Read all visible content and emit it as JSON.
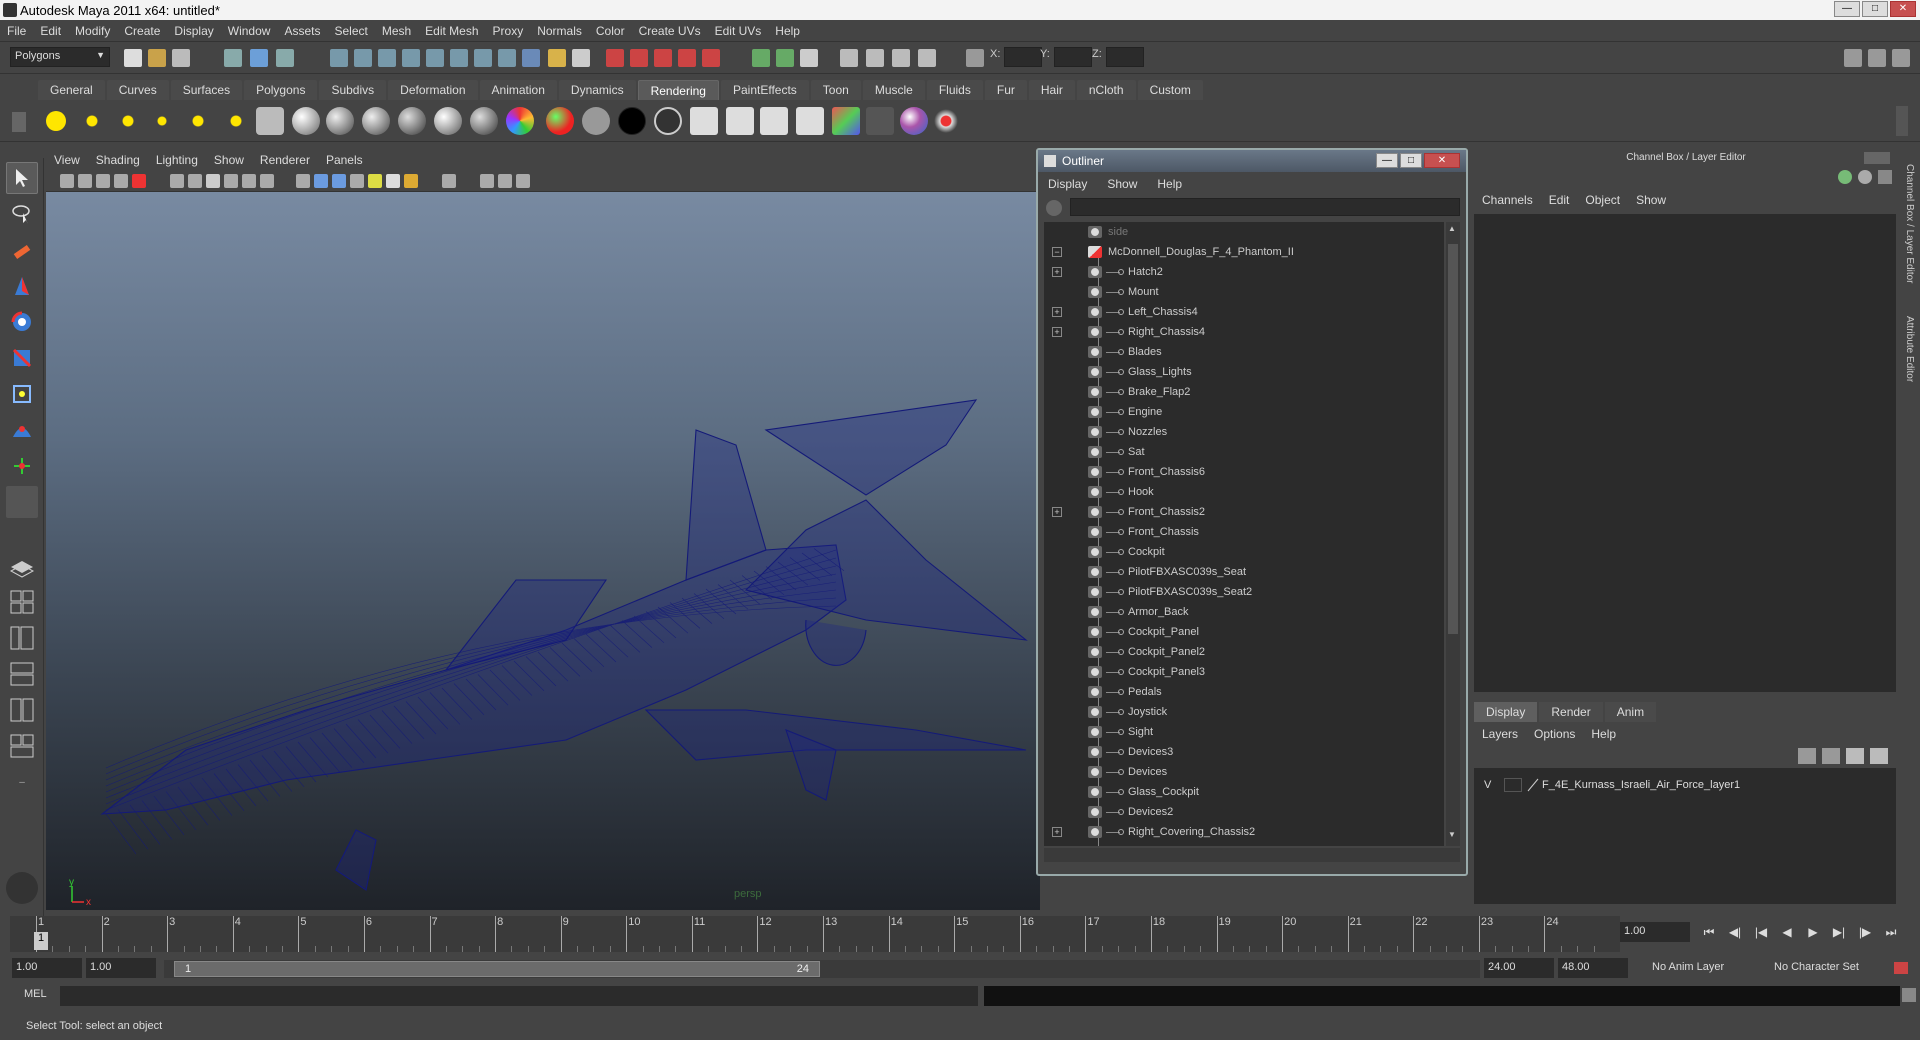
{
  "window": {
    "title": "Autodesk Maya 2011 x64: untitled*"
  },
  "menubar": [
    "File",
    "Edit",
    "Modify",
    "Create",
    "Display",
    "Window",
    "Assets",
    "Select",
    "Mesh",
    "Edit Mesh",
    "Proxy",
    "Normals",
    "Color",
    "Create UVs",
    "Edit UVs",
    "Help"
  ],
  "statusline": {
    "mode": "Polygons",
    "x_label": "X:",
    "y_label": "Y:",
    "z_label": "Z:"
  },
  "shelf": {
    "tabs": [
      "General",
      "Curves",
      "Surfaces",
      "Polygons",
      "Subdivs",
      "Deformation",
      "Animation",
      "Dynamics",
      "Rendering",
      "PaintEffects",
      "Toon",
      "Muscle",
      "Fluids",
      "Fur",
      "Hair",
      "nCloth",
      "Custom"
    ],
    "active": "Rendering"
  },
  "viewport": {
    "menu": [
      "View",
      "Shading",
      "Lighting",
      "Show",
      "Renderer",
      "Panels"
    ],
    "camera_label": "persp",
    "axis_y": "y",
    "axis_x": "x",
    "wire_color": "#141a78"
  },
  "outliner": {
    "title": "Outliner",
    "menu": [
      "Display",
      "Show",
      "Help"
    ],
    "items": [
      {
        "label": "side",
        "level": 0,
        "expand": "",
        "dim": true
      },
      {
        "label": "McDonnell_Douglas_F_4_Phantom_II",
        "level": 0,
        "expand": "-",
        "dim": false
      },
      {
        "label": "Hatch2",
        "level": 1,
        "expand": "+",
        "dim": false
      },
      {
        "label": "Mount",
        "level": 1,
        "expand": "",
        "dim": false
      },
      {
        "label": "Left_Chassis4",
        "level": 1,
        "expand": "+",
        "dim": false
      },
      {
        "label": "Right_Chassis4",
        "level": 1,
        "expand": "+",
        "dim": false
      },
      {
        "label": "Blades",
        "level": 1,
        "expand": "",
        "dim": false
      },
      {
        "label": "Glass_Lights",
        "level": 1,
        "expand": "",
        "dim": false
      },
      {
        "label": "Brake_Flap2",
        "level": 1,
        "expand": "",
        "dim": false
      },
      {
        "label": "Engine",
        "level": 1,
        "expand": "",
        "dim": false
      },
      {
        "label": "Nozzles",
        "level": 1,
        "expand": "",
        "dim": false
      },
      {
        "label": "Sat",
        "level": 1,
        "expand": "",
        "dim": false
      },
      {
        "label": "Front_Chassis6",
        "level": 1,
        "expand": "",
        "dim": false
      },
      {
        "label": "Hook",
        "level": 1,
        "expand": "",
        "dim": false
      },
      {
        "label": "Front_Chassis2",
        "level": 1,
        "expand": "+",
        "dim": false
      },
      {
        "label": "Front_Chassis",
        "level": 1,
        "expand": "",
        "dim": false
      },
      {
        "label": "Cockpit",
        "level": 1,
        "expand": "",
        "dim": false
      },
      {
        "label": "PilotFBXASC039s_Seat",
        "level": 1,
        "expand": "",
        "dim": false
      },
      {
        "label": "PilotFBXASC039s_Seat2",
        "level": 1,
        "expand": "",
        "dim": false
      },
      {
        "label": "Armor_Back",
        "level": 1,
        "expand": "",
        "dim": false
      },
      {
        "label": "Cockpit_Panel",
        "level": 1,
        "expand": "",
        "dim": false
      },
      {
        "label": "Cockpit_Panel2",
        "level": 1,
        "expand": "",
        "dim": false
      },
      {
        "label": "Cockpit_Panel3",
        "level": 1,
        "expand": "",
        "dim": false
      },
      {
        "label": "Pedals",
        "level": 1,
        "expand": "",
        "dim": false
      },
      {
        "label": "Joystick",
        "level": 1,
        "expand": "",
        "dim": false
      },
      {
        "label": "Sight",
        "level": 1,
        "expand": "",
        "dim": false
      },
      {
        "label": "Devices3",
        "level": 1,
        "expand": "",
        "dim": false
      },
      {
        "label": "Devices",
        "level": 1,
        "expand": "",
        "dim": false
      },
      {
        "label": "Glass_Cockpit",
        "level": 1,
        "expand": "",
        "dim": false
      },
      {
        "label": "Devices2",
        "level": 1,
        "expand": "",
        "dim": false
      },
      {
        "label": "Right_Covering_Chassis2",
        "level": 1,
        "expand": "+",
        "dim": false
      }
    ]
  },
  "channelbox": {
    "title": "Channel Box / Layer Editor",
    "menu": [
      "Channels",
      "Edit",
      "Object",
      "Show"
    ],
    "layer_tabs": [
      "Display",
      "Render",
      "Anim"
    ],
    "layer_menu": [
      "Layers",
      "Options",
      "Help"
    ],
    "layer_visible": "V",
    "layer_name": "F_4E_Kurnass_Israeli_Air_Force_layer1",
    "side_tab_1": "Channel Box / Layer Editor",
    "side_tab_2": "Attribute Editor"
  },
  "timeline": {
    "ticks": [
      "1",
      "2",
      "3",
      "4",
      "5",
      "6",
      "7",
      "8",
      "9",
      "10",
      "11",
      "12",
      "13",
      "14",
      "15",
      "16",
      "17",
      "18",
      "19",
      "20",
      "21",
      "22",
      "23",
      "24"
    ],
    "current_frame_marker": "1",
    "current_frame": "1.00"
  },
  "range": {
    "start": "1.00",
    "playback_start": "1.00",
    "thumb_start": "1",
    "thumb_end": "24",
    "playback_end": "24.00",
    "end": "48.00",
    "anim_layer": "No Anim Layer",
    "character_set": "No Character Set"
  },
  "command": {
    "label": "MEL"
  },
  "help": {
    "text": "Select Tool: select an object"
  }
}
